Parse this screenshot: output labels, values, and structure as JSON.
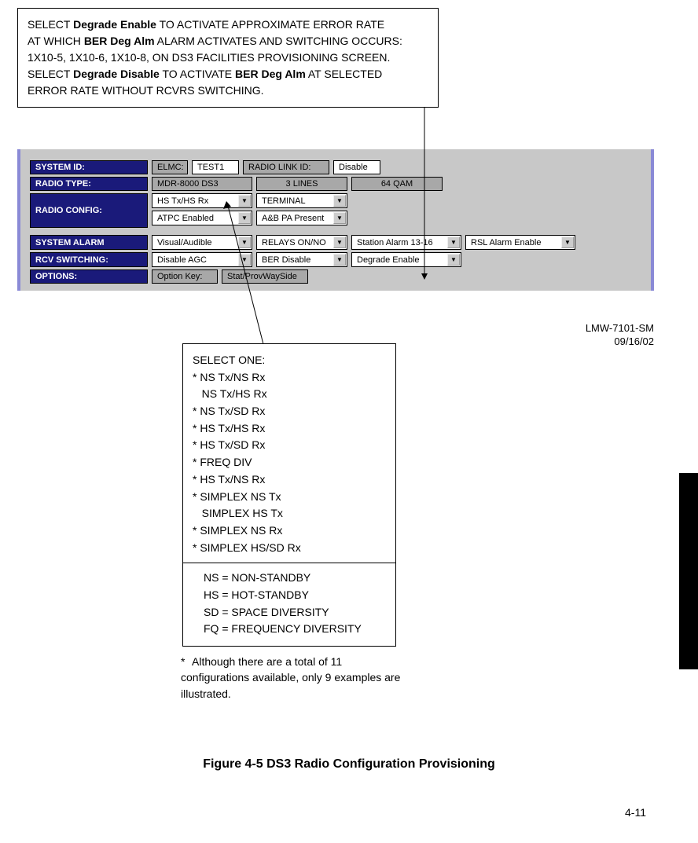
{
  "callout_top": {
    "line1a": "SELECT ",
    "line1b": "Degrade Enable",
    "line1c": " TO ACTIVATE APPROXIMATE ERROR RATE",
    "line2a": "AT WHICH ",
    "line2b": "BER Deg Alm",
    "line2c": " ALARM ACTIVATES AND SWITCHING OCCURS:",
    "line3": "1X10-5, 1X10-6, 1X10-8, ON DS3 FACILITIES PROVISIONING SCREEN.",
    "line4a": "SELECT ",
    "line4b": "Degrade Disable",
    "line4c": " TO ACTIVATE ",
    "line4d": "BER Deg Alm",
    "line4e": " AT SELECTED",
    "line5": "ERROR  RATE WITHOUT RCVRS SWITCHING."
  },
  "labels": {
    "system_id": "SYSTEM ID:",
    "radio_type": "RADIO TYPE:",
    "radio_config": "RADIO CONFIG:",
    "system_alarm": "SYSTEM ALARM",
    "rcv_switching": "RCV SWITCHING:",
    "options": "OPTIONS:",
    "elmc": "ELMC:",
    "radio_link_id": "RADIO LINK ID:",
    "option_key": "Option Key:"
  },
  "values": {
    "elmc": "TEST1",
    "radio_link_id": "Disable",
    "radio_type1": "MDR-8000 DS3",
    "radio_type2": "3 LINES",
    "radio_type3": "64 QAM",
    "cfg1": "HS Tx/HS Rx",
    "cfg2": "TERMINAL",
    "cfg3": "ATPC Enabled",
    "cfg4": "A&B PA Present",
    "alarm1": "Visual/Audible",
    "alarm2": "RELAYS ON/NO",
    "alarm3": "Station Alarm 13-16",
    "alarm4": "RSL Alarm Enable",
    "rcv1": "Disable AGC",
    "rcv2": "BER Disable",
    "rcv3": "Degrade Enable",
    "opt_val": "Stat/ProvWaySide"
  },
  "stamp": {
    "l1": "LMW-7101-SM",
    "l2": "09/16/02"
  },
  "callout_mid": {
    "title": "SELECT ONE:",
    "items": [
      "* NS Tx/NS Rx",
      "   NS Tx/HS Rx",
      "* NS Tx/SD Rx",
      "* HS Tx/HS Rx",
      "* HS Tx/SD Rx",
      "* FREQ DIV",
      "* HS Tx/NS Rx",
      "* SIMPLEX NS Tx",
      "   SIMPLEX HS Tx",
      "* SIMPLEX NS Rx",
      "* SIMPLEX HS/SD Rx"
    ],
    "defs": [
      "NS = NON-STANDBY",
      "HS = HOT-STANDBY",
      "SD = SPACE DIVERSITY",
      "FQ = FREQUENCY DIVERSITY"
    ]
  },
  "footnote": {
    "star": "*",
    "text": "Although there are a total of 11 configurations available, only 9 examples are illustrated."
  },
  "caption": "Figure 4-5  DS3 Radio Configuration Provisioning",
  "page_num": "4-11"
}
